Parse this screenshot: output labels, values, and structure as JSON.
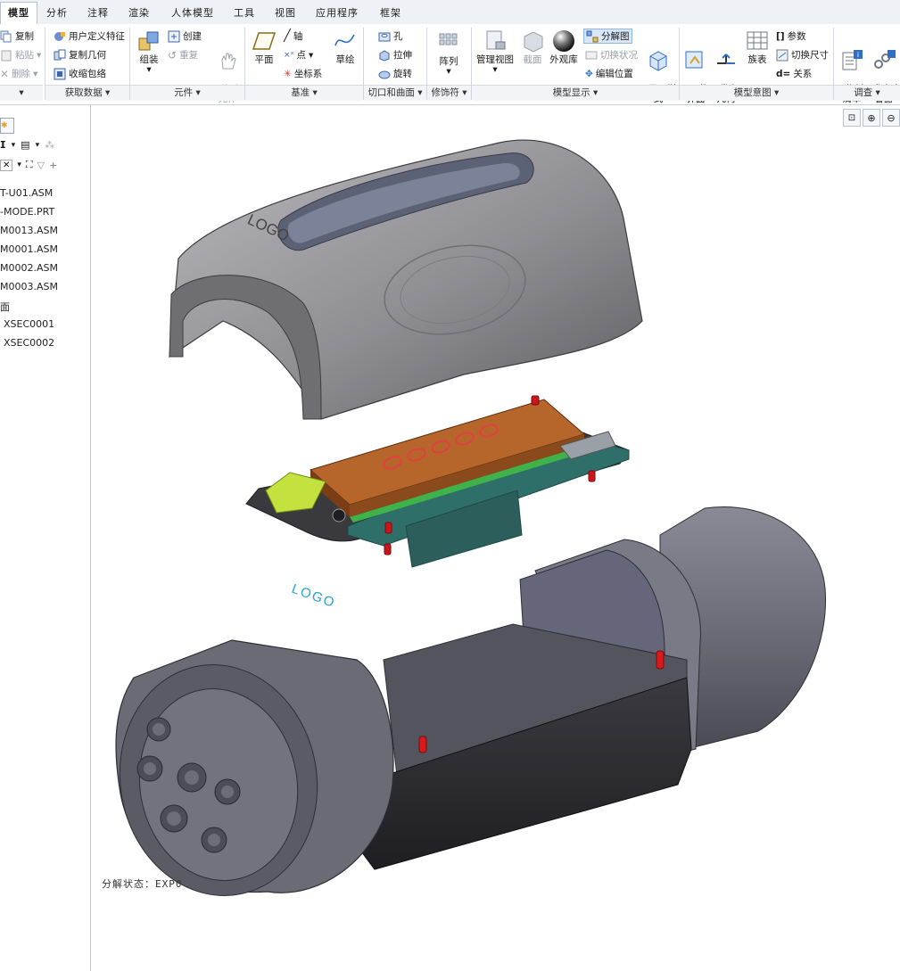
{
  "tabs": [
    {
      "label": "模型",
      "active": true
    },
    {
      "label": "分析"
    },
    {
      "label": "注释"
    },
    {
      "label": "渲染"
    },
    {
      "label": "人体模型"
    },
    {
      "label": "工具"
    },
    {
      "label": "视图"
    },
    {
      "label": "应用程序"
    },
    {
      "label": "框架"
    }
  ],
  "ribbon": {
    "clipboard": {
      "copy": "复制",
      "paste": "粘贴",
      "delete": "删除"
    },
    "get_data": {
      "user_feature": "用户定义特征",
      "copy_geom": "复制几何",
      "shrinkwrap": "收缩包络",
      "footer": "获取数据"
    },
    "component": {
      "assemble": "组装",
      "create": "创建",
      "repeat": "重复",
      "drag": "拖动\n元件",
      "footer": "元件"
    },
    "datum": {
      "plane": "平面",
      "axis": "轴",
      "point": "点",
      "csys": "坐标系",
      "sketch": "草绘",
      "footer": "基准"
    },
    "cut_surface": {
      "hole": "孔",
      "extrude": "拉伸",
      "revolve": "旋转",
      "footer": "切口和曲面"
    },
    "modifier": {
      "pattern": "阵列",
      "footer": "修饰符"
    },
    "model_display": {
      "manage_views": "管理视图",
      "section": "截面",
      "appearance": "外观库",
      "explode": "分解图",
      "toggle_status": "切换状况",
      "edit_position": "编辑位置",
      "display_style": "显示样\n式",
      "footer": "模型显示"
    },
    "model_intent": {
      "comp_interface": "元件\n界面",
      "publish_geom": "发布\n几何",
      "family_table": "族表",
      "params": "参数",
      "toggle_dims": "切换尺寸",
      "relations": "关系",
      "footer": "模型意图"
    },
    "investigate": {
      "bom": "物料\n清单",
      "ref_viewer": "参考查\n看器",
      "footer": "调查"
    }
  },
  "tree": {
    "items": [
      "T-U01.ASM",
      "-MODE.PRT",
      "M0013.ASM",
      "M0001.ASM",
      "M0002.ASM",
      "M0003.ASM",
      "面",
      "XSEC0001",
      "XSEC0002"
    ]
  },
  "viewport": {
    "logo_text": "LOGO",
    "status_label": "分解状态：EXP0"
  },
  "colors": {
    "accent": "#2f6fc4",
    "housing": "#6f6f7a",
    "lid": "#8d8d92",
    "pcb": "#2f6f6a",
    "display": "#8a4a1c",
    "pin": "#d41b1b"
  }
}
